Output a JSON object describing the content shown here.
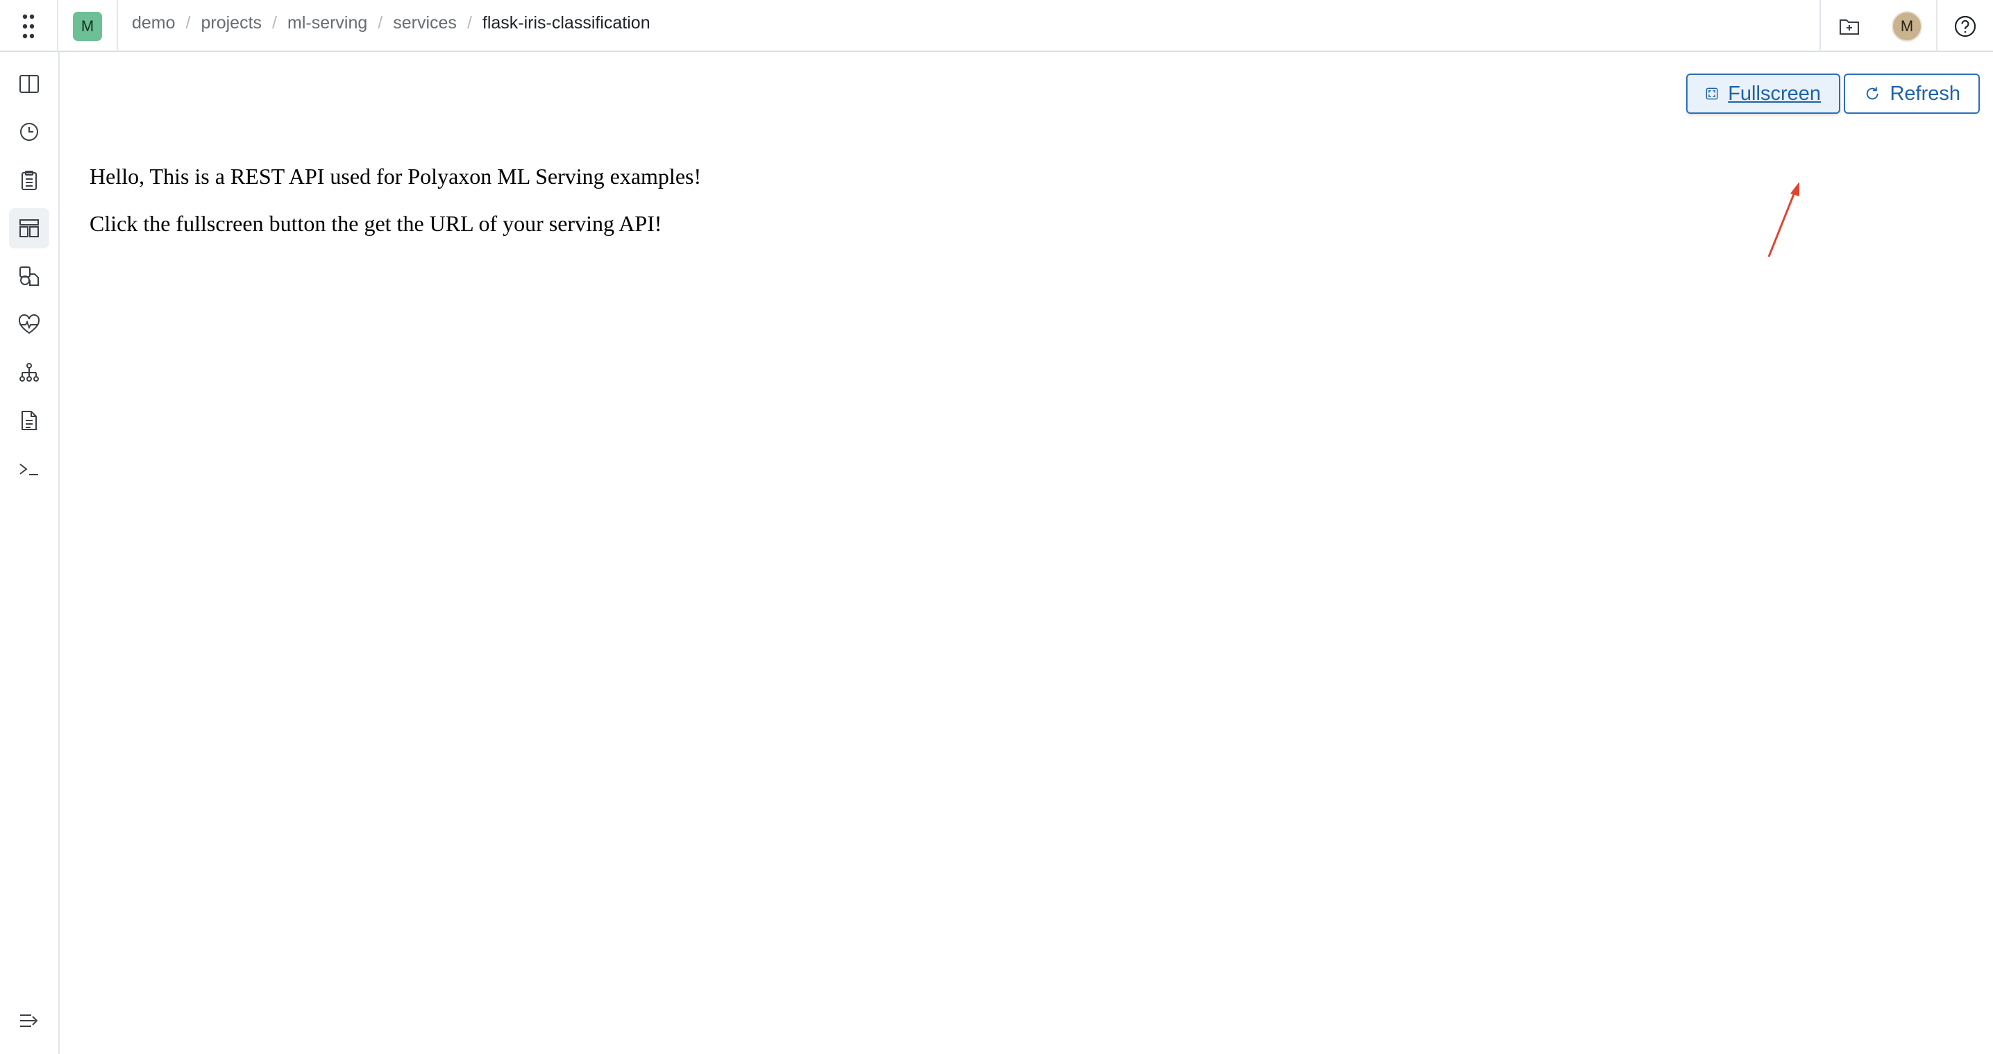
{
  "header": {
    "org_avatar": "M",
    "breadcrumb": [
      "demo",
      "projects",
      "ml-serving",
      "services"
    ],
    "breadcrumb_sep": "/",
    "breadcrumb_current": "flask-iris-classification",
    "user_avatar": "M"
  },
  "sidebar": {
    "items": [
      {
        "icon": "columns-icon"
      },
      {
        "icon": "clock-icon"
      },
      {
        "icon": "clipboard-icon"
      },
      {
        "icon": "dashboard-icon",
        "active": true
      },
      {
        "icon": "artifacts-icon"
      },
      {
        "icon": "heart-monitor-icon"
      },
      {
        "icon": "hierarchy-icon"
      },
      {
        "icon": "document-icon"
      },
      {
        "icon": "terminal-icon"
      }
    ],
    "footer_icon": "expand-sidebar-icon"
  },
  "toolbar": {
    "fullscreen_label": "Fullscreen",
    "refresh_label": "Refresh"
  },
  "service_frame": {
    "line1": "Hello, This is a REST API used for Polyaxon ML Serving examples!",
    "line2": "Click the fullscreen button the get the URL of your serving API!"
  },
  "colors": {
    "accent": "#1d63a8",
    "annotation_arrow": "#e0442e",
    "org_avatar_bg": "#6dbf95"
  }
}
